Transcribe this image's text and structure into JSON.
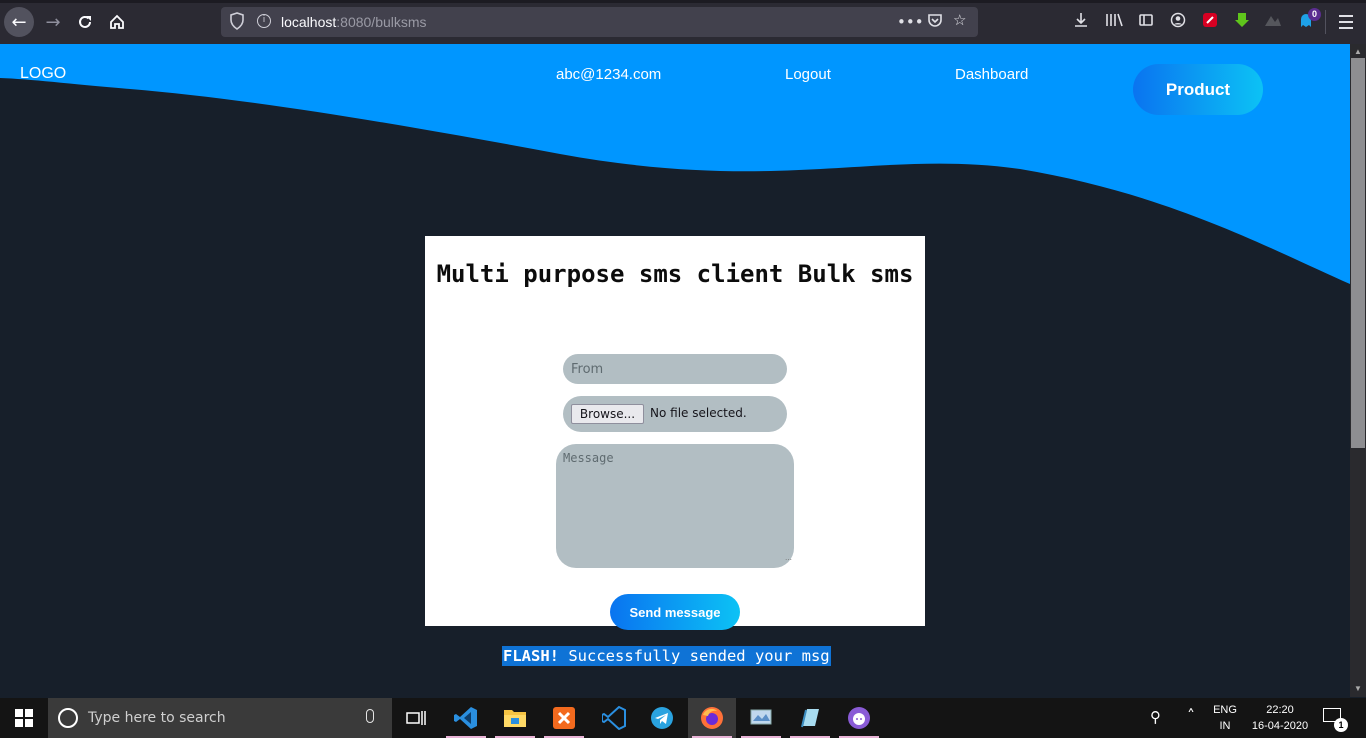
{
  "browser": {
    "url_host": "localhost",
    "url_path": ":8080/bulksms",
    "icons": [
      "back-arrow-icon",
      "forward-arrow-icon",
      "reload-icon",
      "home-icon",
      "shield-icon",
      "info-icon",
      "more-dots-icon",
      "pocket-icon",
      "star-icon",
      "download-icon",
      "library-icon",
      "sidebar-icon",
      "account-icon",
      "extension-icon"
    ],
    "extension_badge": "0"
  },
  "header": {
    "logo": "LOGO",
    "email": "abc@1234.com",
    "logout": "Logout",
    "dashboard": "Dashboard",
    "product": "Product"
  },
  "form": {
    "title": "Multi purpose sms client Bulk sms",
    "from_placeholder": "From",
    "browse_label": "Browse...",
    "file_status": "No file selected.",
    "message_placeholder": "Message",
    "send_label": "Send message"
  },
  "flash": {
    "label": "FLASH!",
    "text": " Successfully sended your msg"
  },
  "taskbar": {
    "search_placeholder": "Type here to search",
    "lang_line1": "ENG",
    "lang_line2": "IN",
    "time": "22:20",
    "date": "16-04-2020",
    "notification_count": "1"
  },
  "colors": {
    "header_blue": "#0096ff",
    "page_bg": "#171f2a",
    "button_gradient_start": "#0a74f0",
    "button_gradient_end": "#0cc2f5",
    "input_bg": "#b2bec3",
    "flash_bg": "#0f73d6"
  }
}
